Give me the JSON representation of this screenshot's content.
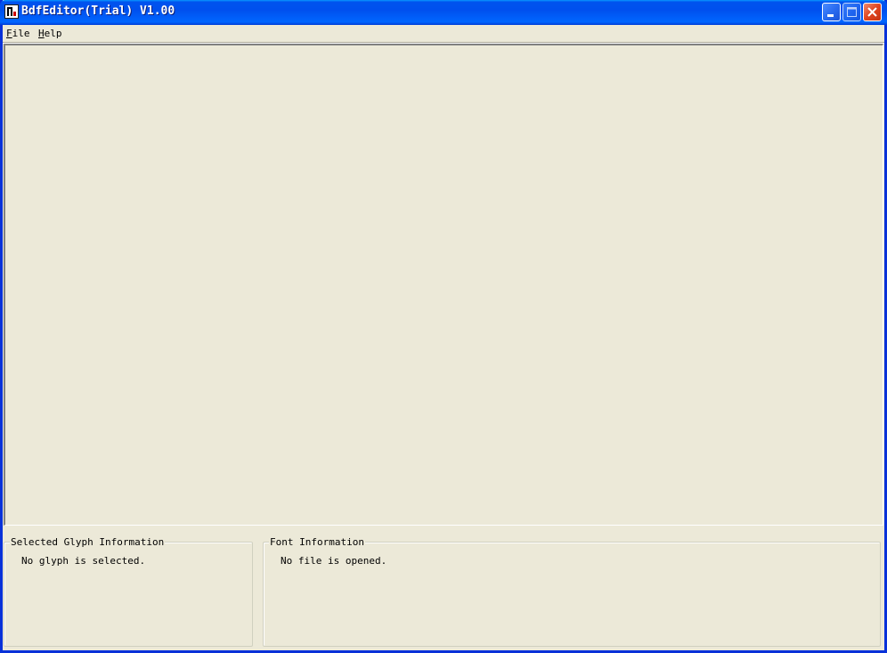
{
  "window": {
    "title": "BdfEditor(Trial) V1.00",
    "icon": "app-icon",
    "controls": {
      "minimize": "minimize-icon",
      "maximize": "maximize-icon",
      "close": "close-icon"
    }
  },
  "menu": {
    "items": [
      {
        "label_accel": "F",
        "label_rest": "ile"
      },
      {
        "label_accel": "H",
        "label_rest": "elp"
      }
    ]
  },
  "panels": {
    "glyph": {
      "title": "Selected Glyph Information",
      "text": "No glyph is selected."
    },
    "font": {
      "title": "Font Information",
      "text": "No file is opened."
    }
  },
  "colors": {
    "titlebar": "#0053ee",
    "window_bg": "#ece9d8",
    "close_button": "#e0451f"
  }
}
